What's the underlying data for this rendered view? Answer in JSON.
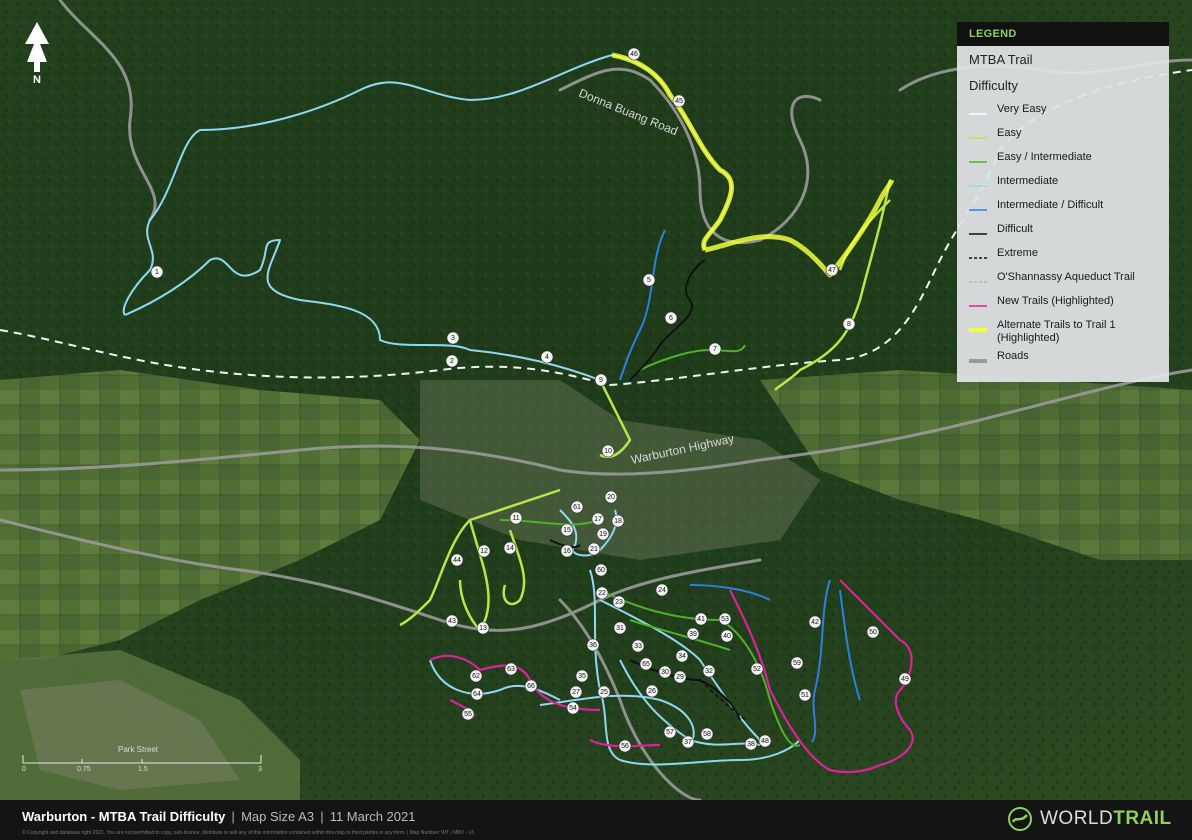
{
  "map": {
    "title": "Warburton - MTBA Trail Difficulty",
    "map_size": "Map Size A3",
    "date": "11 March 2021",
    "copyright": "© Copyright and database right 2021. You are not permitted to copy, sub-licence, distribute or sell any of this information contained within this map to third parties in any form. | Map Number: WT / MBV - v3",
    "north_label": "N",
    "road_labels": [
      "Donna Buang Road",
      "Warburton Highway",
      "Park Street"
    ],
    "scale_labels": [
      "0",
      "0.75",
      "1.5",
      "3"
    ]
  },
  "legend": {
    "header": "LEGEND",
    "section": "MTBA Trail",
    "subsection": "Difficulty",
    "items": [
      {
        "label": "Very Easy",
        "color": "#ffffff",
        "style": "solid"
      },
      {
        "label": "Easy",
        "color": "#b8e64a",
        "style": "solid"
      },
      {
        "label": "Easy / Intermediate",
        "color": "#4fb12a",
        "style": "solid"
      },
      {
        "label": "Intermediate",
        "color": "#8fd8f2",
        "style": "solid"
      },
      {
        "label": "Intermediate / Difficult",
        "color": "#2d7fe0",
        "style": "solid"
      },
      {
        "label": "Difficult",
        "color": "#111111",
        "style": "solid"
      },
      {
        "label": "Extreme",
        "color": "#111111",
        "style": "dashed"
      },
      {
        "label": "O'Shannassy Aqueduct Trail",
        "color": "#ffffff",
        "style": "dash-white"
      },
      {
        "label": "New Trails (Highlighted)",
        "color": "#e0209a",
        "style": "solid"
      },
      {
        "label": "Alternate Trails to Trail 1 (Highlighted)",
        "color": "#f2ff3a",
        "style": "thick"
      },
      {
        "label": "Roads",
        "color": "#9a9a9a",
        "style": "thick"
      }
    ]
  },
  "trail_numbers": [
    "1",
    "2",
    "3",
    "4",
    "5",
    "6",
    "7",
    "8",
    "9",
    "10",
    "11",
    "12",
    "13",
    "14",
    "15",
    "16",
    "17",
    "18",
    "19",
    "20",
    "21",
    "22",
    "23",
    "24",
    "25",
    "26",
    "27",
    "28",
    "29",
    "30",
    "31",
    "32",
    "33",
    "34",
    "35",
    "36",
    "37",
    "38",
    "39",
    "40",
    "41",
    "42",
    "43",
    "44",
    "45",
    "46",
    "47",
    "48",
    "49",
    "50",
    "51",
    "52",
    "53",
    "54",
    "55",
    "56",
    "57",
    "58",
    "59",
    "60",
    "61",
    "62",
    "63",
    "64",
    "65",
    "66"
  ],
  "brand": {
    "world": "WORLD",
    "trail": "TRAIL"
  }
}
